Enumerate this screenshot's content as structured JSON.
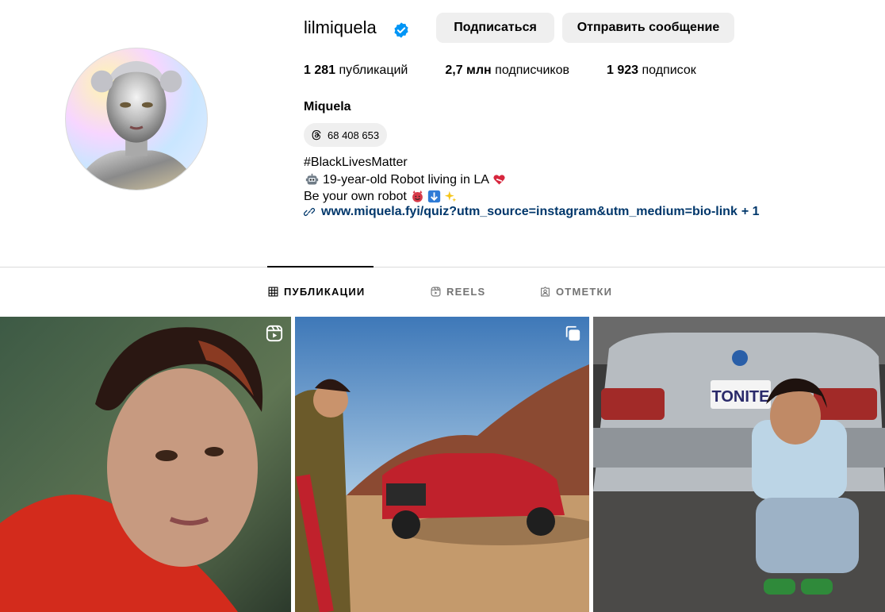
{
  "profile": {
    "username": "lilmiquela",
    "verified": true,
    "follow_label": "Подписаться",
    "message_label": "Отправить сообщение",
    "stats": {
      "posts_count": "1 281",
      "posts_label": "публикаций",
      "followers_count": "2,7 млн",
      "followers_label": "подписчиков",
      "following_count": "1 923",
      "following_label": "подписок"
    },
    "full_name": "Miquela",
    "threads_count": "68 408 653",
    "bio": {
      "line1": "#BlackLivesMatter",
      "line2": "19-year-old Robot living in LA",
      "line3": "Be your own robot",
      "link": "www.miquela.fyi/quiz?utm_source=instagram&utm_medium=bio-link",
      "link_more": "+ 1"
    }
  },
  "tabs": {
    "posts": "ПУБЛИКАЦИИ",
    "reels": "REELS",
    "tagged": "ОТМЕТКИ"
  },
  "grid": [
    {
      "type": "reel",
      "badge": "reels-icon"
    },
    {
      "type": "carousel",
      "badge": "carousel-icon"
    },
    {
      "type": "photo",
      "plate_text": "TONITE"
    }
  ],
  "colors": {
    "verified": "#0095f6",
    "link": "#00376b",
    "button_bg": "#efefef",
    "muted": "#737373"
  }
}
